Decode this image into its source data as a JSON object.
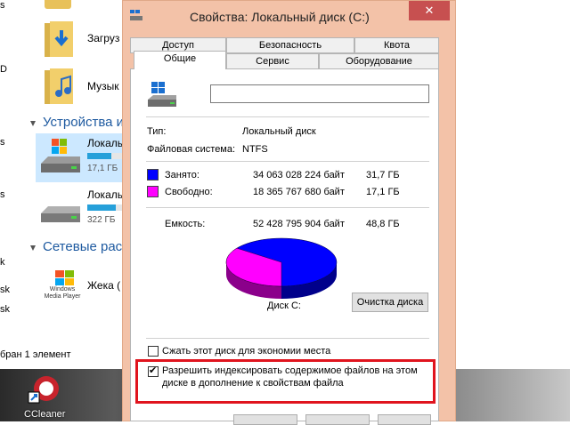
{
  "explorer": {
    "items": [
      {
        "label": "Загруз",
        "icon": "downloads-folder-icon"
      },
      {
        "label": "Музык",
        "icon": "music-folder-icon"
      }
    ],
    "sections": {
      "devices": "Устройства и",
      "network": "Сетевые рас"
    },
    "drives": [
      {
        "label": "Локаль",
        "size": "17,1 ГБ",
        "used_fraction": 0.65
      },
      {
        "label": "Локаль",
        "size": "322 ГБ",
        "used_fraction": 0.75
      }
    ],
    "media": {
      "label": "Жека (",
      "icon_caption": "Windows Media Player"
    },
    "status": "бран 1 элемент",
    "left_edge_fragments": [
      "s",
      "D",
      "s",
      "s",
      "k",
      "sk",
      "sk"
    ]
  },
  "desktop": {
    "shortcut_label": "CCleaner"
  },
  "dialog": {
    "title": "Свойства: Локальный диск (C:)",
    "close_symbol": "✕",
    "tabs_row1": [
      "Доступ",
      "Безопасность",
      "Квота"
    ],
    "tabs_row2": [
      "Общие",
      "Сервис",
      "Оборудование"
    ],
    "active_tab": "Общие",
    "name_value": "",
    "type_label": "Тип:",
    "type_value": "Локальный диск",
    "fs_label": "Файловая система:",
    "fs_value": "NTFS",
    "used": {
      "label": "Занято:",
      "bytes": "34 063 028 224 байт",
      "human": "31,7 ГБ",
      "color": "#0000ff"
    },
    "free": {
      "label": "Свободно:",
      "bytes": "18 365 767 680 байт",
      "human": "17,1 ГБ",
      "color": "#ff00ff"
    },
    "capacity": {
      "label": "Емкость:",
      "bytes": "52 428 795 904 байт",
      "human": "48,8 ГБ"
    },
    "used_fraction": 0.65,
    "disk_label": "Диск C:",
    "cleanup_button": "Очистка диска",
    "compress_label": "Сжать этот диск для экономии места",
    "compress_checked": false,
    "index_label_line1": "Разрешить индексировать содержимое файлов на этом",
    "index_label_line2": "диске в дополнение к свойствам файла",
    "index_checked": true
  }
}
